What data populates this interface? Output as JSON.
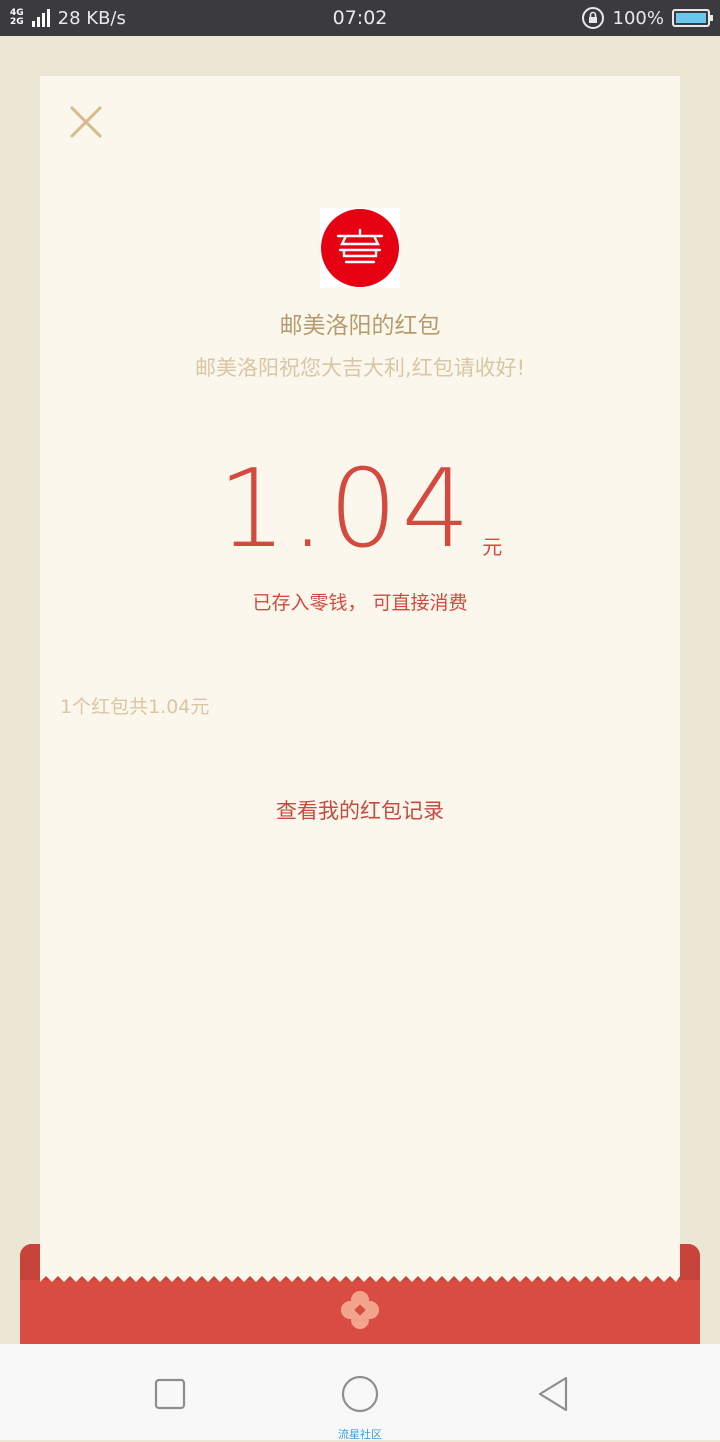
{
  "status_bar": {
    "network_top": "4G",
    "network_bottom": "2G",
    "speed": "28 KB/s",
    "time": "07:02",
    "battery": "100%",
    "battery_level": 1.0
  },
  "card": {
    "sender_name": "邮美洛阳的红包",
    "greeting": "邮美洛阳祝您大吉大利,红包请收好!",
    "amount": "1.04",
    "unit": "元",
    "deposit_note": "已存入零钱， 可直接消费",
    "summary": "1个红包共1.04元",
    "record_link": "查看我的红包记录"
  },
  "watermark": "流星社区",
  "colors": {
    "accent_red": "#d44a3f",
    "envelope_red": "#d94c42",
    "gold": "#b69c6c",
    "paper": "#fbf7ec"
  }
}
